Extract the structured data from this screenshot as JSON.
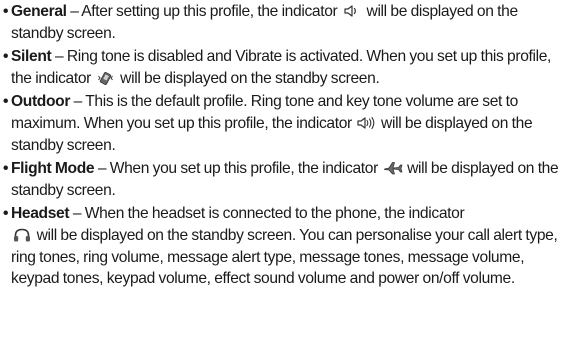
{
  "items": [
    {
      "bullet": "•",
      "term": "General",
      "text_before": " – After setting up this profile, the indicator ",
      "icon": "speaker-icon",
      "text_after": " will be displayed on the standby screen."
    },
    {
      "bullet": "•",
      "term": "Silent",
      "text_before": " – Ring tone is disabled and Vibrate is activated. When you set up this profile, the indicator ",
      "icon": "vibrate-icon",
      "text_after": " will be displayed on the standby screen."
    },
    {
      "bullet": "•",
      "term": "Outdoor",
      "text_before": " – This is the default profile. Ring tone and key tone volume are set to maximum. When you set up this profile, the indicator ",
      "icon": "loud-speaker-icon",
      "text_after": " will be displayed on the standby screen."
    },
    {
      "bullet": "•",
      "term": "Flight Mode",
      "text_before": " – When you set up this profile, the indicator ",
      "icon": "airplane-icon",
      "text_after": " will be displayed on the standby screen."
    },
    {
      "bullet": "•",
      "term": "Headset",
      "text_before": " – When the headset is connected to the phone, the indicator ",
      "icon": "headset-icon",
      "text_after": " will be displayed on the standby screen. You can personalise your call alert type, ring tones, ring volume, message alert type, message tones, message volume, keypad tones, keypad volume, effect sound volume and power on/off volume."
    }
  ]
}
